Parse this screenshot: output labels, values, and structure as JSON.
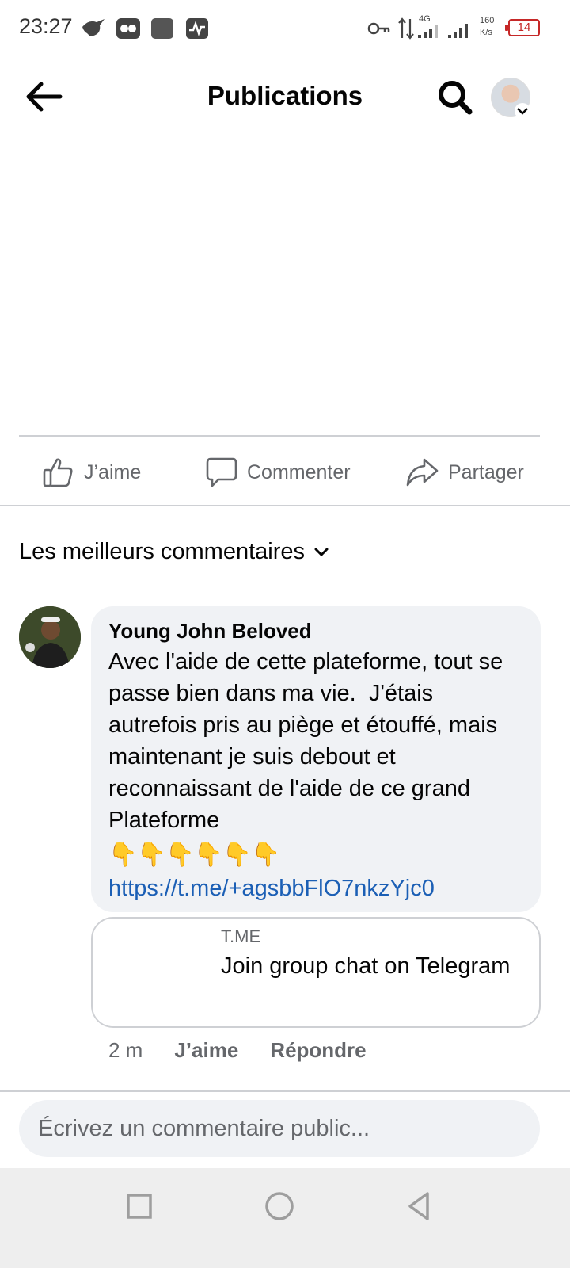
{
  "status_bar": {
    "time": "23:27",
    "network": "4G",
    "speed_value": "160",
    "speed_unit": "K/s",
    "battery": "14"
  },
  "header": {
    "title": "Publications"
  },
  "actions": {
    "like": "J’aime",
    "comment": "Commenter",
    "share": "Partager"
  },
  "sort": {
    "label": "Les meilleurs commentaires"
  },
  "comment": {
    "author": "Young John Beloved",
    "text": "Avec l'aide de cette plateforme, tout se passe bien dans ma vie.  J'étais autrefois pris au piège et étouffé, mais maintenant je suis debout et reconnaissant de l'aide de ce grand Plateforme",
    "emojis": "👇👇👇👇👇👇",
    "link": "https://t.me/+agsbbFlO7nkzYjc0",
    "link_card": {
      "domain": "T.ME",
      "title": "Join group chat on Telegram"
    },
    "time": "2 m",
    "like_label": "J’aime",
    "reply_label": "Répondre"
  },
  "composer": {
    "placeholder": "Écrivez un commentaire public..."
  },
  "colors": {
    "link_blue": "#1b5fb5",
    "secondary_text": "#65676b",
    "bubble_bg": "#f0f2f5",
    "battery_red": "#c62828"
  }
}
